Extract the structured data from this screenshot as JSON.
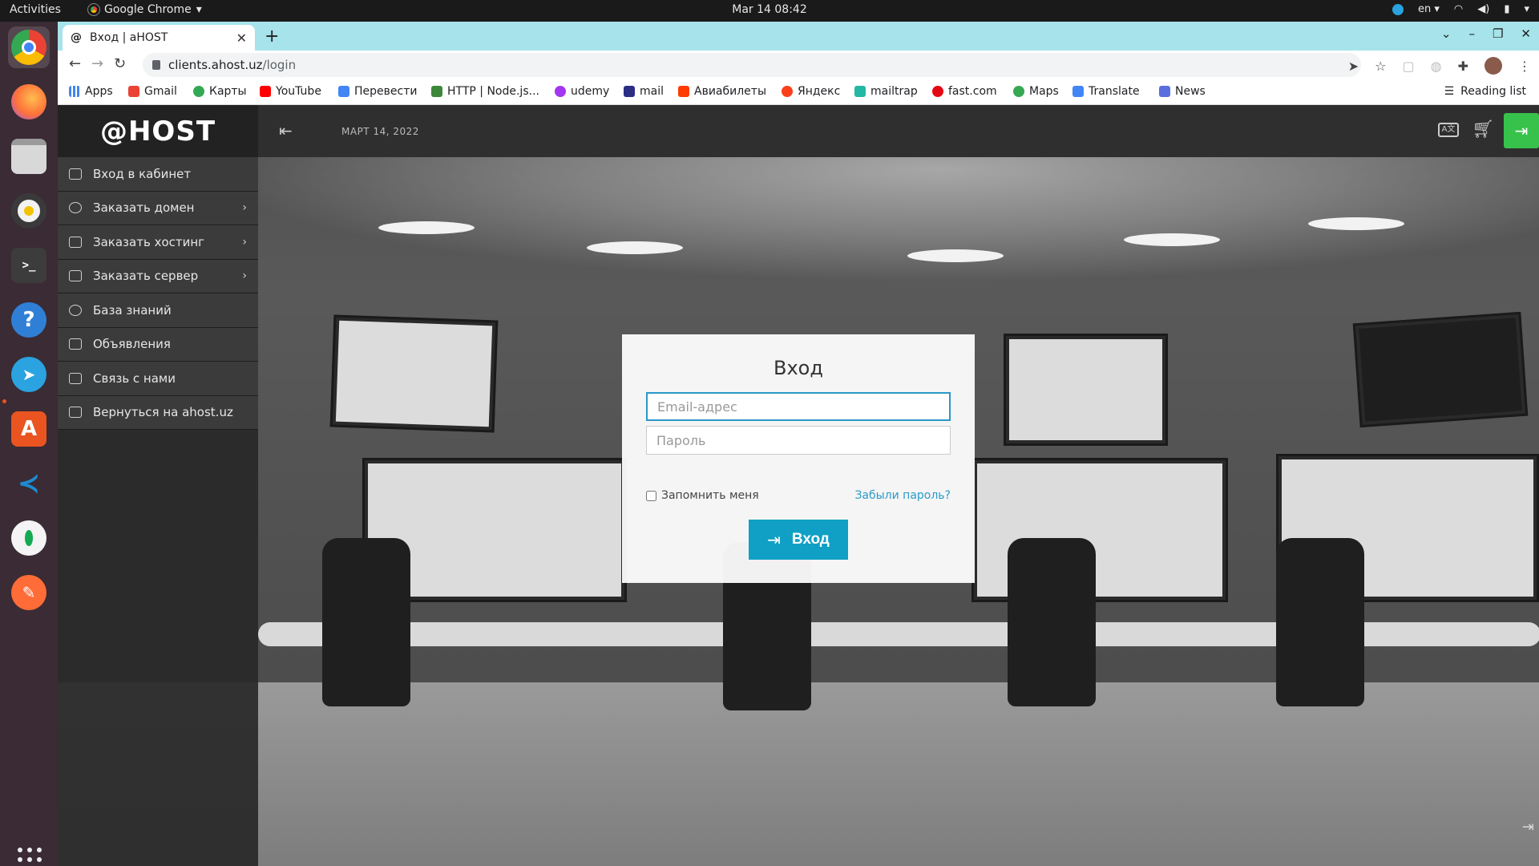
{
  "system": {
    "activities": "Activities",
    "app_menu": "Google Chrome",
    "clock": "Mar 14  08:42",
    "lang": "en"
  },
  "browser": {
    "tab_favicon": "@",
    "tab_title": "Вход | aHOST",
    "url_host": "clients.ahost.uz",
    "url_path": "/login",
    "bookmarks": [
      {
        "label": "Apps",
        "color": "#4285f4"
      },
      {
        "label": "Gmail",
        "color": "#ea4335"
      },
      {
        "label": "Карты",
        "color": "#34a853"
      },
      {
        "label": "YouTube",
        "color": "#ff0000"
      },
      {
        "label": "Перевести",
        "color": "#4285f4"
      },
      {
        "label": "HTTP | Node.js...",
        "color": "#3c873a"
      },
      {
        "label": "udemy",
        "color": "#a435f0"
      },
      {
        "label": "mail",
        "color": "#2c2d85"
      },
      {
        "label": "Авиабилеты",
        "color": "#ff3b00"
      },
      {
        "label": "Яндекс",
        "color": "#fc3f1d"
      },
      {
        "label": "mailtrap",
        "color": "#22b8a4"
      },
      {
        "label": "fast.com",
        "color": "#e50914"
      },
      {
        "label": "Maps",
        "color": "#34a853"
      },
      {
        "label": "Translate",
        "color": "#4285f4"
      },
      {
        "label": "News",
        "color": "#5a6ee0"
      }
    ],
    "reading_list": "Reading list"
  },
  "site": {
    "logo": "@HOST",
    "date": "МАРТ 14, 2022",
    "translate_icon_text": "A文",
    "menu": [
      {
        "label": "Вход в кабинет",
        "submenu": false
      },
      {
        "label": "Заказать домен",
        "submenu": true
      },
      {
        "label": "Заказать хостинг",
        "submenu": true
      },
      {
        "label": "Заказать сервер",
        "submenu": true
      },
      {
        "label": "База знаний",
        "submenu": false
      },
      {
        "label": "Объявления",
        "submenu": false
      },
      {
        "label": "Связь с нами",
        "submenu": false
      },
      {
        "label": "Вернуться на ahost.uz",
        "submenu": false
      }
    ]
  },
  "login": {
    "title": "Вход",
    "email_placeholder": "Email-адрес",
    "password_placeholder": "Пароль",
    "remember_label": "Запомнить меня",
    "forgot_label": "Забыли пароль?",
    "submit_label": "Вход"
  },
  "colors": {
    "accent": "#10a0c5",
    "green": "#37c24b",
    "tabstrip": "#a6e3ea"
  }
}
